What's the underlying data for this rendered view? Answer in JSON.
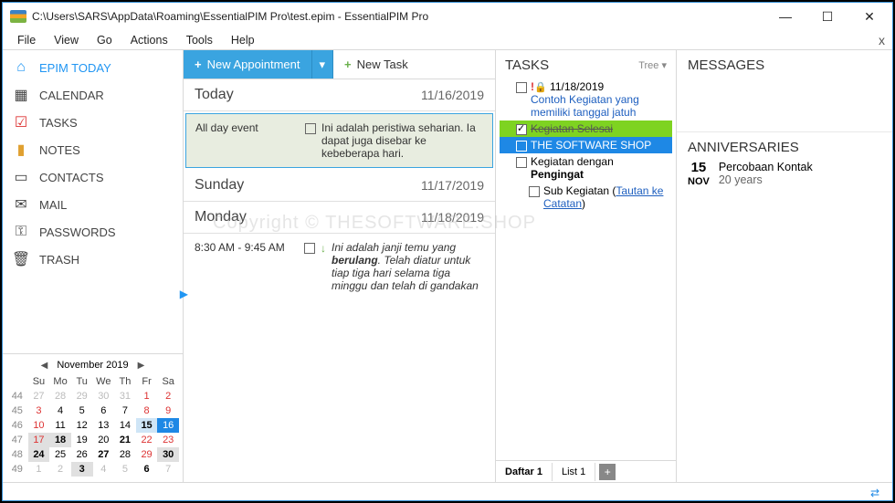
{
  "title": "C:\\Users\\SARS\\AppData\\Roaming\\EssentialPIM Pro\\test.epim - EssentialPIM Pro",
  "menu": [
    "File",
    "View",
    "Go",
    "Actions",
    "Tools",
    "Help"
  ],
  "sidebar": {
    "items": [
      {
        "label": "EPIM TODAY"
      },
      {
        "label": "CALENDAR"
      },
      {
        "label": "TASKS"
      },
      {
        "label": "NOTES"
      },
      {
        "label": "CONTACTS"
      },
      {
        "label": "MAIL"
      },
      {
        "label": "PASSWORDS"
      },
      {
        "label": "TRASH"
      }
    ]
  },
  "minical": {
    "title": "November  2019",
    "dows": [
      "Su",
      "Mo",
      "Tu",
      "We",
      "Th",
      "Fr",
      "Sa"
    ],
    "weeks": [
      {
        "wk": "44",
        "days": [
          {
            "d": "27",
            "cls": "other"
          },
          {
            "d": "28",
            "cls": "other"
          },
          {
            "d": "29",
            "cls": "other"
          },
          {
            "d": "30",
            "cls": "other"
          },
          {
            "d": "31",
            "cls": "other"
          },
          {
            "d": "1",
            "cls": "wkend"
          },
          {
            "d": "2",
            "cls": "wkend"
          }
        ]
      },
      {
        "wk": "45",
        "days": [
          {
            "d": "3",
            "cls": "wkend"
          },
          {
            "d": "4"
          },
          {
            "d": "5"
          },
          {
            "d": "6"
          },
          {
            "d": "7"
          },
          {
            "d": "8",
            "cls": "wkend"
          },
          {
            "d": "9",
            "cls": "wkend"
          }
        ]
      },
      {
        "wk": "46",
        "days": [
          {
            "d": "10",
            "cls": "wkend"
          },
          {
            "d": "11"
          },
          {
            "d": "12"
          },
          {
            "d": "13"
          },
          {
            "d": "14"
          },
          {
            "d": "15",
            "cls": "wkend bold sel"
          },
          {
            "d": "16",
            "cls": "today"
          }
        ]
      },
      {
        "wk": "47",
        "days": [
          {
            "d": "17",
            "cls": "wkend hl"
          },
          {
            "d": "18",
            "cls": "bold hl"
          },
          {
            "d": "19"
          },
          {
            "d": "20"
          },
          {
            "d": "21",
            "cls": "bold"
          },
          {
            "d": "22",
            "cls": "wkend"
          },
          {
            "d": "23",
            "cls": "wkend"
          }
        ]
      },
      {
        "wk": "48",
        "days": [
          {
            "d": "24",
            "cls": "wkend bold hl"
          },
          {
            "d": "25"
          },
          {
            "d": "26"
          },
          {
            "d": "27",
            "cls": "bold"
          },
          {
            "d": "28"
          },
          {
            "d": "29",
            "cls": "wkend"
          },
          {
            "d": "30",
            "cls": "wkend bold hl"
          }
        ]
      },
      {
        "wk": "49",
        "days": [
          {
            "d": "1",
            "cls": "other"
          },
          {
            "d": "2",
            "cls": "other"
          },
          {
            "d": "3",
            "cls": "other bold hl"
          },
          {
            "d": "4",
            "cls": "other"
          },
          {
            "d": "5",
            "cls": "other"
          },
          {
            "d": "6",
            "cls": "other bold"
          },
          {
            "d": "7",
            "cls": "other"
          }
        ]
      }
    ]
  },
  "toolbar": {
    "new_appt": "New Appointment",
    "new_task": "New Task"
  },
  "days": [
    {
      "name": "Today",
      "date": "11/16/2019",
      "events": [
        {
          "time": "All day event",
          "text": "Ini adalah peristiwa seharian. Ia dapat juga disebar ke kebeberapa hari.",
          "hl": true
        }
      ]
    },
    {
      "name": "Sunday",
      "date": "11/17/2019",
      "events": []
    },
    {
      "name": "Monday",
      "date": "11/18/2019",
      "events": [
        {
          "time": "8:30 AM - 9:45 AM",
          "text": "Ini adalah janji temu yang ",
          "bold": "berulang",
          "text2": ". Telah diatur untuk tiap tiga hari selama tiga minggu dan telah di gandakan",
          "recurring": true
        }
      ]
    }
  ],
  "tasks": {
    "title": "TASKS",
    "mode": "Tree",
    "items": [
      {
        "date": "11/18/2019",
        "text": "Contoh Kegiatan yang memiliki tanggal jatuh",
        "link": true,
        "priority": true,
        "lock": true
      },
      {
        "text": "Kegiatan Selesai",
        "done": true,
        "green": true
      },
      {
        "text": "THE SOFTWARE SHOP",
        "blue": true
      },
      {
        "text": "Kegiatan dengan ",
        "bold": "Pengingat"
      },
      {
        "text": "Sub Kegiatan (",
        "link_text": "Tautan ke Catatan",
        "suffix": ")",
        "indent": 2
      }
    ],
    "tabs": [
      "Daftar 1",
      "List 1"
    ]
  },
  "messages": {
    "title": "MESSAGES"
  },
  "anniv": {
    "title": "ANNIVERSARIES",
    "day": "15",
    "month": "NOV",
    "name": "Percobaan Kontak",
    "age": "20 years"
  },
  "watermark": "Copyright © THESOFTWARE.SHOP"
}
